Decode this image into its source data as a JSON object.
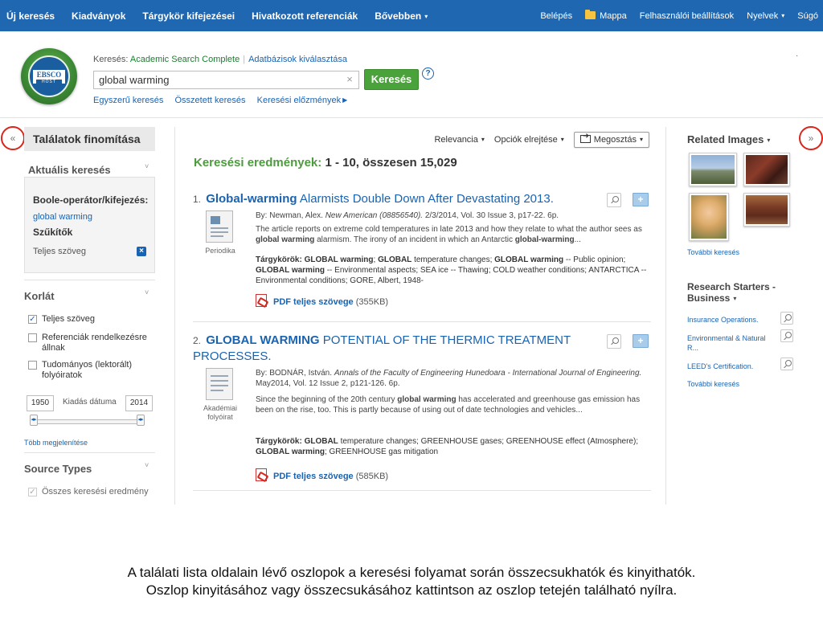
{
  "topnav": {
    "left": [
      "Új keresés",
      "Kiadványok",
      "Tárgykör kifejezései",
      "Hivatkozott referenciák",
      "Bővebben"
    ],
    "more_caret": "▾",
    "right": [
      "Belépés",
      "Mappa",
      "Felhasználói beállítások",
      "Nyelvek",
      "Súgó"
    ],
    "languages_caret": "▾"
  },
  "logo": {
    "text": "EBSCO",
    "sub": "HOST"
  },
  "search": {
    "label": "Keresés:",
    "database": "Academic Search Complete",
    "choose_db": "Adatbázisok kiválasztása",
    "query": "global warming",
    "clear": "×",
    "button": "Keresés",
    "help": "?",
    "links": [
      "Egyszerű keresés",
      "Összetett keresés",
      "Keresési előzmények"
    ]
  },
  "collapse": {
    "left": "«",
    "right": "»"
  },
  "left": {
    "refine_title": "Találatok finomítása",
    "current_search_title": "Aktuális keresés",
    "boolean_label": "Boole-operátor/kifejezés:",
    "boolean_value": "global warming",
    "limiters_label": "Szűkítők",
    "limiter_value": "Teljes szöveg",
    "limiter_remove": "×",
    "limit_title": "Korlát",
    "checkboxes": [
      {
        "label": "Teljes szöveg",
        "checked": "✓"
      },
      {
        "label": "Referenciák rendelkezésre állnak",
        "checked": ""
      },
      {
        "label": "Tudományos (lektorált) folyóiratok",
        "checked": ""
      }
    ],
    "date_from": "1950",
    "date_label": "Kiadás dátuma",
    "date_to": "2014",
    "handle_glyph": "◂▸",
    "more_options": "Több megjelenítése",
    "source_types_title": "Source Types",
    "source_all": "Összes keresési eredmény",
    "source_all_check": "✓",
    "chevron": "˅"
  },
  "main": {
    "sort": "Relevancia",
    "options": "Opciók elrejtése",
    "share": "Megosztás",
    "caret": "▾",
    "results_heading": "Keresési eredmények:",
    "results_count": "1 - 10, összesen 15,029",
    "results": [
      {
        "num": "1.",
        "title_html_parts": [
          "Global-warming",
          " Alarmists Double Down After Devastating 2013."
        ],
        "type": "Periodika",
        "byline_pre": "By: Newman, Alex. ",
        "byline_source": "New American (08856540).",
        "byline_post": " 2/3/2014, Vol. 30 Issue 3, p17-22. 6p.",
        "abstract_parts": [
          "The article reports on extreme cold temperatures in late 2013 and how they relate to what the author sees as ",
          "global warming",
          " alarmism. The irony of an incident in which an Antarctic ",
          "global-warming",
          "..."
        ],
        "subjects_label": "Tárgykörök:",
        "subjects_parts": [
          " ",
          "GLOBAL warming",
          "; ",
          "GLOBAL",
          " temperature changes; ",
          "GLOBAL warming",
          " -- Public opinion; ",
          "GLOBAL warming",
          " -- Environmental aspects; SEA ice -- Thawing; COLD weather conditions; ANTARCTICA -- Environmental conditions; GORE, Albert, 1948-"
        ],
        "pdf_text": "PDF teljes szövege",
        "pdf_size": "(355KB)"
      },
      {
        "num": "2.",
        "title_html_parts": [
          "GLOBAL WARMING",
          " POTENTIAL OF THE THERMIC TREATMENT PROCESSES."
        ],
        "type": "Akadémiai folyóirat",
        "byline_pre": "By: BODNÁR, István. ",
        "byline_source": "Annals of the Faculty of Engineering Hunedoara - International Journal of Engineering.",
        "byline_post": " May2014, Vol. 12 Issue 2, p121-126. 6p.",
        "abstract_parts": [
          "Since the beginning of the 20th century ",
          "global warming",
          " has accelerated and greenhouse gas emission has been on the rise, too. This is partly because of using out of date technologies and vehicles..."
        ],
        "subjects_label": "Tárgykörök:",
        "subjects_parts": [
          " ",
          "GLOBAL",
          " temperature changes; GREENHOUSE gases; GREENHOUSE effect (Atmosphere); ",
          "GLOBAL warming",
          "; GREENHOUSE gas mitigation"
        ],
        "pdf_text": "PDF teljes szövege",
        "pdf_size": "(585KB)"
      }
    ]
  },
  "right": {
    "related_images": "Related Images",
    "caret": "▾",
    "more_search_1": "További keresés",
    "research_title": "Research Starters -",
    "research_title_2": "Business",
    "research_items": [
      "Insurance Operations.",
      "Environmental & Natural R...",
      "LEED's Certification."
    ],
    "more_search_2": "További keresés"
  },
  "caption": {
    "line1": "A találati lista oldalain lévő oszlopok a keresési folyamat során összecsukhatók és kinyithatók.",
    "line2": "Oszlop kinyitásához vagy összecsukásához kattintson az oszlop tetején található nyílra."
  },
  "colors": {
    "nav_bg": "#1f67b0",
    "link": "#1a63b0",
    "green": "#4aa23a",
    "highlight_red": "#d9261c"
  }
}
